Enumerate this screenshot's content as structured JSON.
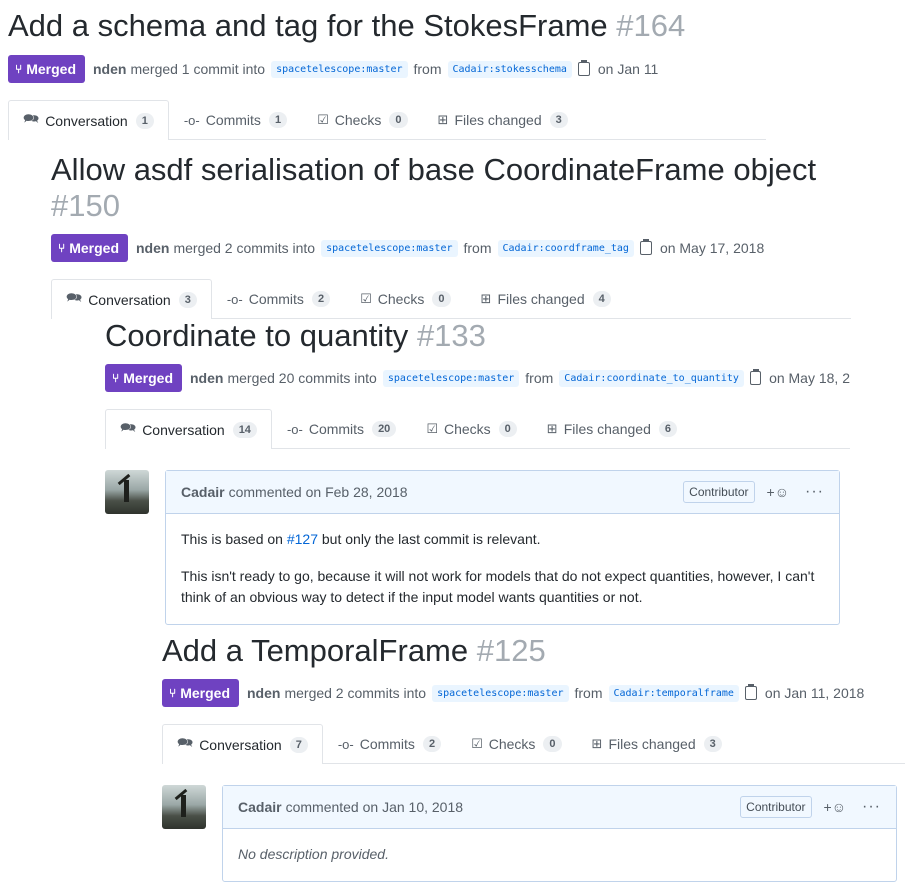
{
  "prs": [
    {
      "title": "Add a schema and tag for the StokesFrame",
      "number": "#164",
      "state": "Merged",
      "author": "nden",
      "action": "merged 1 commit into",
      "base": "spacetelescope:master",
      "from": "from",
      "head": "Cadair:stokesschema",
      "date": "on Jan 11",
      "tabs": [
        {
          "label": "Conversation",
          "count": "1"
        },
        {
          "label": "Commits",
          "count": "1"
        },
        {
          "label": "Checks",
          "count": "0"
        },
        {
          "label": "Files changed",
          "count": "3"
        }
      ]
    },
    {
      "title": "Allow asdf serialisation of base CoordinateFrame object",
      "number": "#150",
      "state": "Merged",
      "author": "nden",
      "action": "merged 2 commits into",
      "base": "spacetelescope:master",
      "from": "from",
      "head": "Cadair:coordframe_tag",
      "date": "on May 17, 2018",
      "tabs": [
        {
          "label": "Conversation",
          "count": "3"
        },
        {
          "label": "Commits",
          "count": "2"
        },
        {
          "label": "Checks",
          "count": "0"
        },
        {
          "label": "Files changed",
          "count": "4"
        }
      ]
    },
    {
      "title": "Coordinate to quantity",
      "number": "#133",
      "state": "Merged",
      "author": "nden",
      "action": "merged 20 commits into",
      "base": "spacetelescope:master",
      "from": "from",
      "head": "Cadair:coordinate_to_quantity",
      "date": "on May 18, 2",
      "tabs": [
        {
          "label": "Conversation",
          "count": "14"
        },
        {
          "label": "Commits",
          "count": "20"
        },
        {
          "label": "Checks",
          "count": "0"
        },
        {
          "label": "Files changed",
          "count": "6"
        }
      ],
      "comment": {
        "author": "Cadair",
        "when": "commented on Feb 28, 2018",
        "badge": "Contributor",
        "p1_before": "This is based on",
        "p1_link": "#127",
        "p1_after": "but only the last commit is relevant.",
        "p2": "This isn't ready to go, because it will not work for models that do not expect quantities, however, I can't think of an obvious way to detect if the input model wants quantities or not."
      }
    },
    {
      "title": "Add a TemporalFrame",
      "number": "#125",
      "state": "Merged",
      "author": "nden",
      "action": "merged 2 commits into",
      "base": "spacetelescope:master",
      "from": "from",
      "head": "Cadair:temporalframe",
      "date": "on Jan 11, 2018",
      "tabs": [
        {
          "label": "Conversation",
          "count": "7"
        },
        {
          "label": "Commits",
          "count": "2"
        },
        {
          "label": "Checks",
          "count": "0"
        },
        {
          "label": "Files changed",
          "count": "3"
        }
      ],
      "comment": {
        "author": "Cadair",
        "when": "commented on Jan 10, 2018",
        "badge": "Contributor",
        "body": "No description provided."
      }
    }
  ],
  "icons": {
    "merge": "git-merge-icon",
    "conversation": "comment-discussion-icon",
    "commits": "git-commit-icon",
    "checks": "checklist-icon",
    "files": "file-diff-icon",
    "copy": "clippy-icon",
    "reaction": "smiley-icon",
    "more": "kebab-horizontal-icon"
  },
  "colors": {
    "merged": "#6f42c1",
    "link": "#0366d6",
    "branch_bg": "#eaf5ff",
    "comment_header": "#f1f8ff"
  }
}
